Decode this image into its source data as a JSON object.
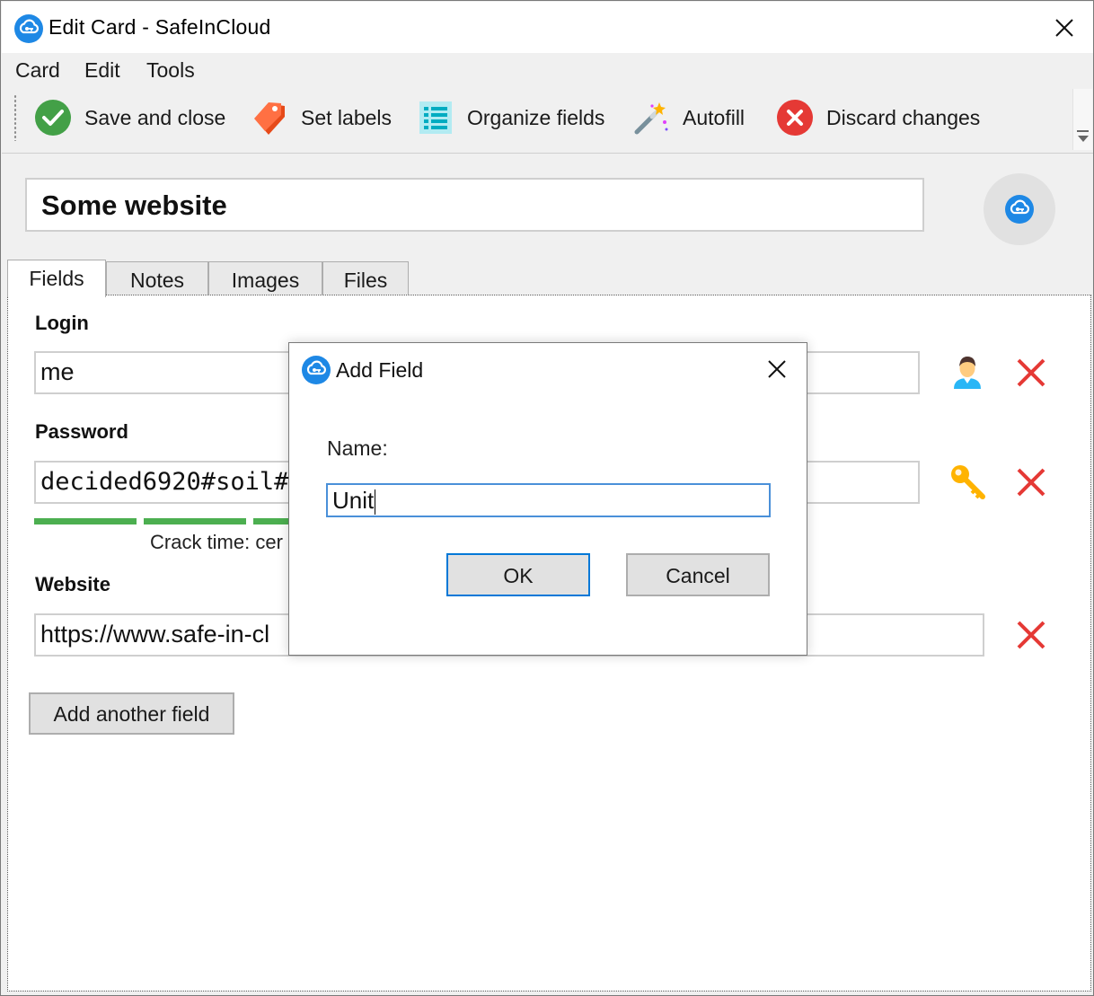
{
  "window": {
    "title": "Edit Card - SafeInCloud",
    "close_label": "Close"
  },
  "menu": [
    "Card",
    "Edit",
    "Tools"
  ],
  "toolbar": {
    "save_close": "Save and close",
    "set_labels": "Set labels",
    "organize_fields": "Organize fields",
    "autofill": "Autofill",
    "discard_changes": "Discard changes"
  },
  "card": {
    "title": "Some website"
  },
  "tabs": [
    "Fields",
    "Notes",
    "Images",
    "Files"
  ],
  "fields": {
    "login": {
      "label": "Login",
      "value": "me"
    },
    "password": {
      "label": "Password",
      "value": "decided6920#soil#",
      "crack_time": "Crack time: cer"
    },
    "website": {
      "label": "Website",
      "value": "https://www.safe-in-cl"
    }
  },
  "add_field_button": "Add another field",
  "dialog": {
    "title": "Add Field",
    "name_label": "Name:",
    "name_value": "Unit",
    "ok": "OK",
    "cancel": "Cancel"
  },
  "colors": {
    "accent_blue": "#1e88e5",
    "strength_green": "#4caf50",
    "delete_red": "#e53935",
    "focus_blue": "#0078d7"
  }
}
